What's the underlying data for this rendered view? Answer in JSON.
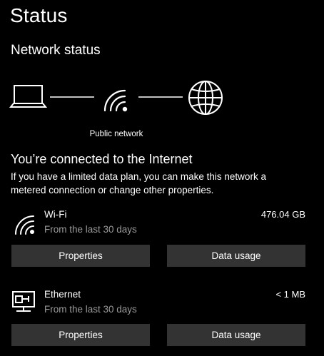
{
  "page": {
    "title": "Status"
  },
  "network_status": {
    "section_title": "Network status",
    "network_label": "Public network",
    "icons": [
      "laptop-icon",
      "wifi-icon",
      "globe-icon"
    ]
  },
  "connection": {
    "title": "You’re connected to the Internet",
    "description": "If you have a limited data plan, you can make this network a metered connection or change other properties."
  },
  "adapters": [
    {
      "name": "Wi-Fi",
      "subtitle": "From the last 30 days",
      "usage": "476.04 GB",
      "icon": "wifi-icon",
      "properties_label": "Properties",
      "data_usage_label": "Data usage"
    },
    {
      "name": "Ethernet",
      "subtitle": "From the last 30 days",
      "usage": "< 1 MB",
      "icon": "ethernet-icon",
      "properties_label": "Properties",
      "data_usage_label": "Data usage"
    }
  ],
  "colors": {
    "background": "#000000",
    "text": "#ffffff",
    "secondary_text": "#9a9a9a",
    "button": "#333333"
  }
}
